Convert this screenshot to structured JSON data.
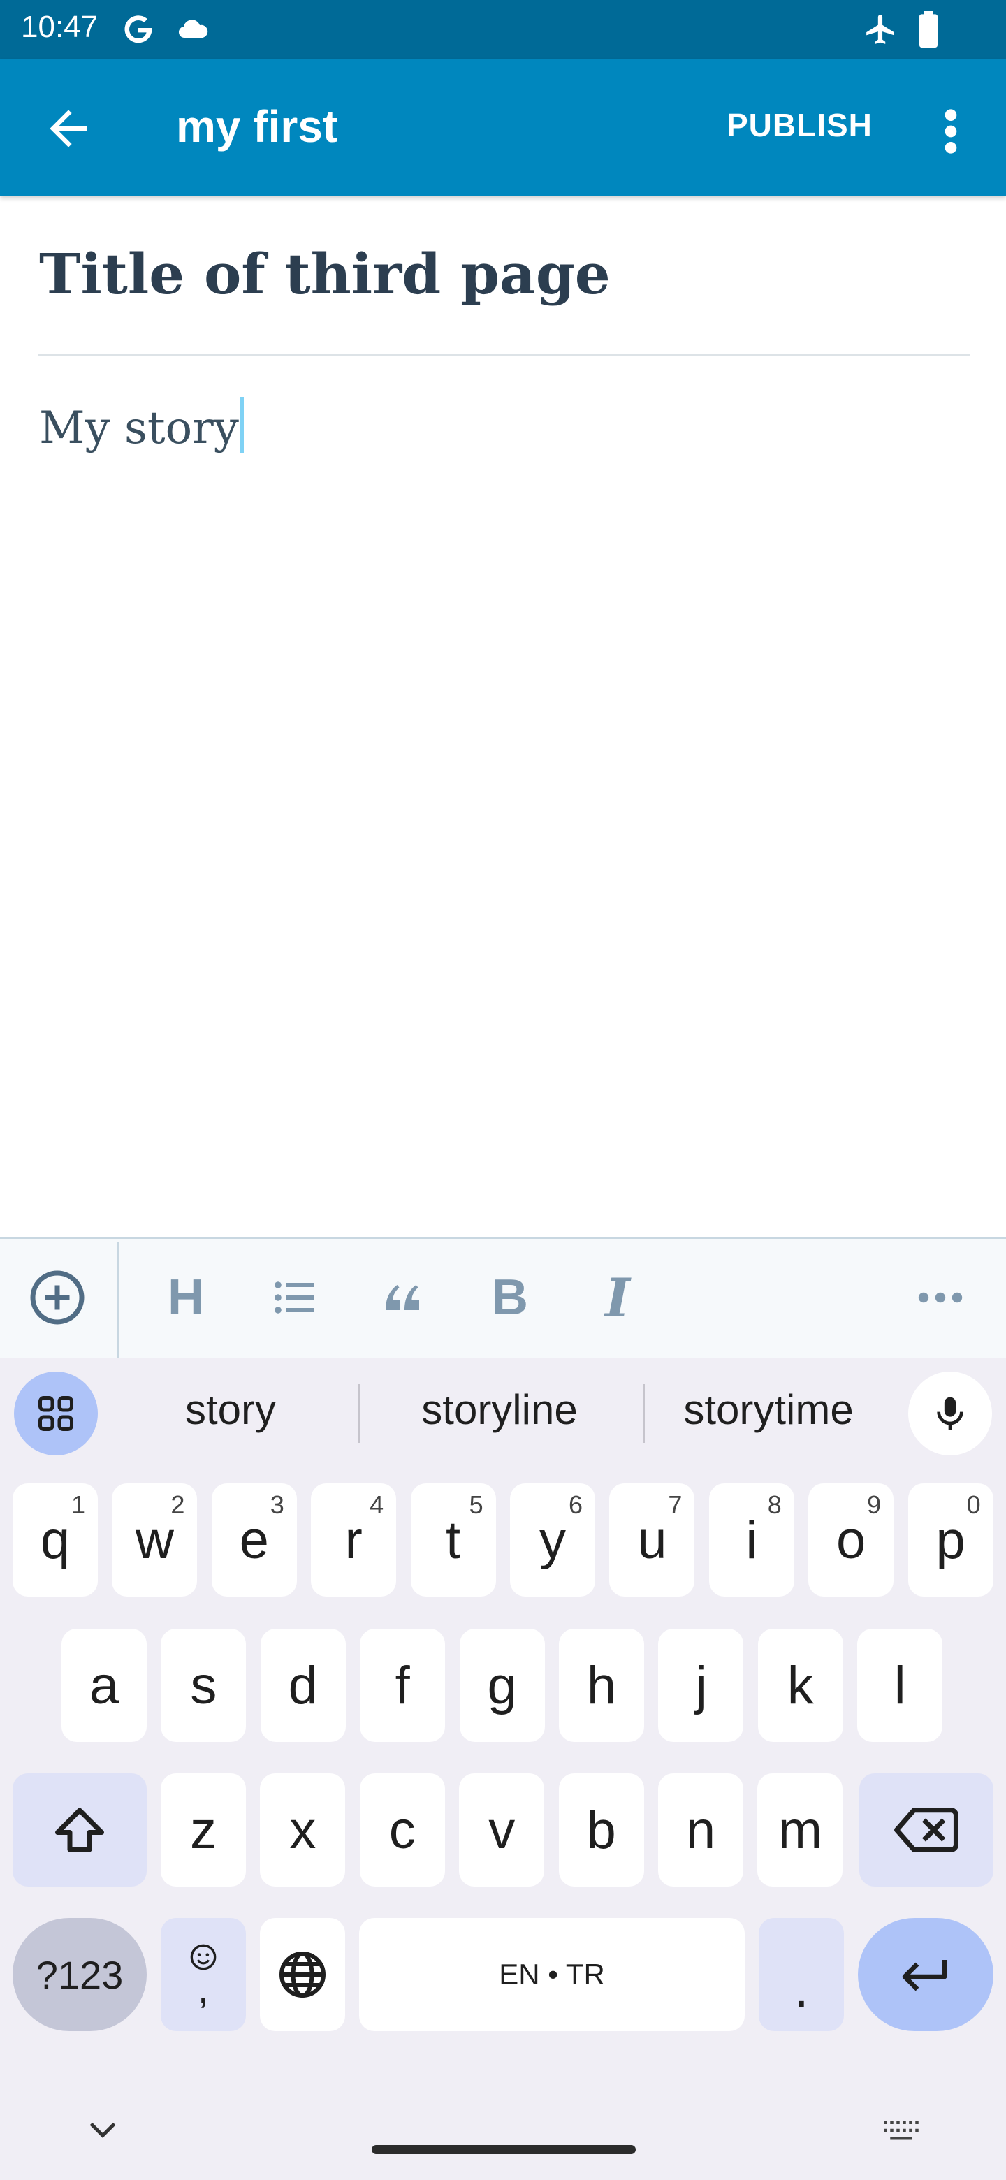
{
  "status_bar": {
    "time": "10:47",
    "icons": [
      "google-icon",
      "cloud-icon",
      "airplane-mode-icon",
      "battery-icon"
    ]
  },
  "app_bar": {
    "title": "my first",
    "publish_label": "PUBLISH",
    "icons": [
      "back-arrow-icon",
      "more-vert-icon"
    ]
  },
  "editor": {
    "title": "Title of third page",
    "body": "My story"
  },
  "format_toolbar": {
    "items": [
      "add-block-icon",
      "heading-icon",
      "list-icon",
      "quote-icon",
      "bold-icon",
      "italic-icon",
      "more-horiz-icon"
    ],
    "heading_glyph": "H",
    "bold_glyph": "B",
    "italic_glyph": "I"
  },
  "keyboard": {
    "suggestions": [
      "story",
      "storyline",
      "storytime"
    ],
    "row1": [
      {
        "key": "q",
        "hint": "1"
      },
      {
        "key": "w",
        "hint": "2"
      },
      {
        "key": "e",
        "hint": "3"
      },
      {
        "key": "r",
        "hint": "4"
      },
      {
        "key": "t",
        "hint": "5"
      },
      {
        "key": "y",
        "hint": "6"
      },
      {
        "key": "u",
        "hint": "7"
      },
      {
        "key": "i",
        "hint": "8"
      },
      {
        "key": "o",
        "hint": "9"
      },
      {
        "key": "p",
        "hint": "0"
      }
    ],
    "row2": [
      "a",
      "s",
      "d",
      "f",
      "g",
      "h",
      "j",
      "k",
      "l"
    ],
    "row3": [
      "z",
      "x",
      "c",
      "v",
      "b",
      "n",
      "m"
    ],
    "symbols_label": "?123",
    "emoji_comma": ",",
    "space_label": "EN • TR",
    "period": "."
  },
  "colors": {
    "status_bar": "#006a97",
    "app_bar": "#0087be",
    "title_text": "#2c3e50",
    "toolbar_icon": "#7f98ad",
    "keyboard_bg": "#f0eef5",
    "enter_key": "#aec3f8"
  }
}
